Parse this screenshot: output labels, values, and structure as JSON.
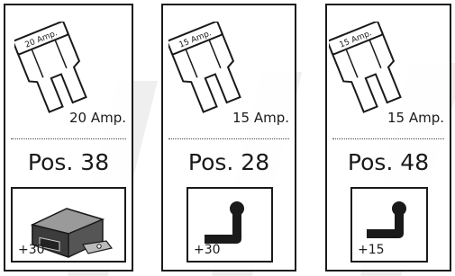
{
  "cards": [
    {
      "fuse_text": "20 Amp.",
      "amp_label": "20 Amp.",
      "position": "Pos. 38",
      "icon": "relay-module-icon",
      "terminal": "+30"
    },
    {
      "fuse_text": "15 Amp.",
      "amp_label": "15 Amp.",
      "position": "Pos. 28",
      "icon": "terminal-connector-icon",
      "terminal": "+30"
    },
    {
      "fuse_text": "15 Amp.",
      "amp_label": "15 Amp.",
      "position": "Pos. 48",
      "icon": "terminal-connector-icon",
      "terminal": "+15"
    }
  ],
  "colors": {
    "line": "#1a1a1a",
    "fuse_fill": "#ffffff",
    "watermark": "#eeeeee"
  }
}
